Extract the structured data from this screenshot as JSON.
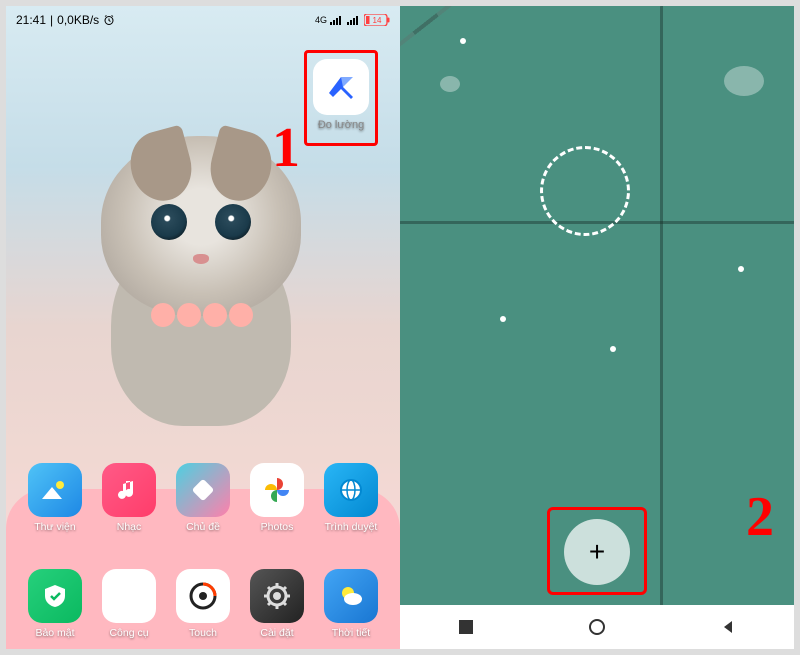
{
  "status": {
    "time": "21:41",
    "speed": "0,0KB/s",
    "network": "4G",
    "battery": "14"
  },
  "highlighted_app": {
    "label": "Đo lường"
  },
  "annotations": {
    "step1": "1",
    "step2": "2"
  },
  "apps_row1": [
    {
      "label": "Thư viện"
    },
    {
      "label": "Nhạc"
    },
    {
      "label": "Chủ đề"
    },
    {
      "label": "Photos"
    },
    {
      "label": "Trình duyệt"
    }
  ],
  "apps_row2": [
    {
      "label": "Bảo mật"
    },
    {
      "label": "Công cụ"
    },
    {
      "label": "Touch"
    },
    {
      "label": "Cài đặt"
    },
    {
      "label": "Thời tiết"
    }
  ],
  "add_button": {
    "glyph": "+"
  }
}
